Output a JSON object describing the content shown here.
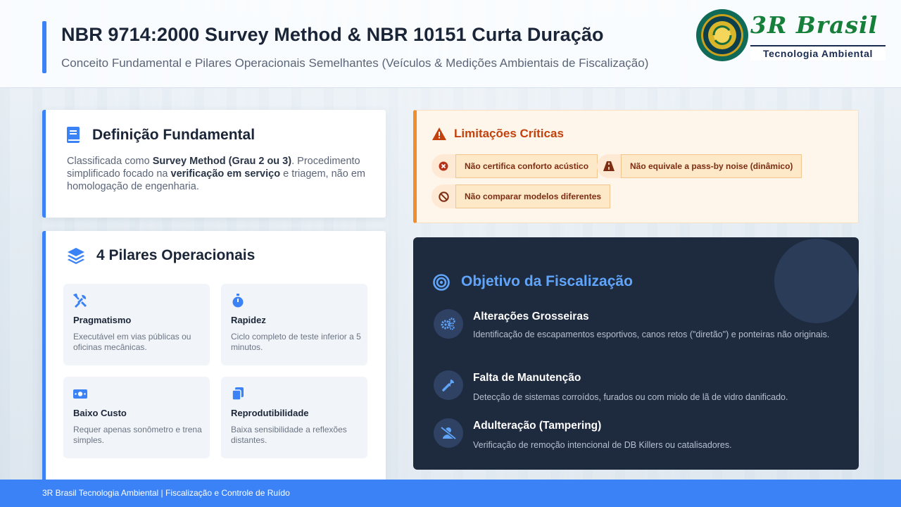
{
  "header": {
    "title": "NBR 9714:2000 Survey Method & NBR 10151 Curta Duração",
    "subtitle": "Conceito Fundamental e Pilares Operacionais Semelhantes (Veículos & Medições Ambientais de Fiscalização)",
    "logo": {
      "brand": "3R Brasil",
      "tagline": "Tecnologia Ambiental"
    }
  },
  "definition": {
    "icon": "book-icon",
    "title": "Definição Fundamental",
    "text_1": "Classificada como ",
    "bold_1": "Survey Method (Grau 2 ou 3)",
    "text_2": ". Procedimento simplificado focado na ",
    "bold_2": "verificação em serviço",
    "text_3": " e triagem, não em homologação de engenharia."
  },
  "pillars": {
    "icon": "layers-icon",
    "title": "4 Pilares Operacionais",
    "items": [
      {
        "icon": "tools-icon",
        "name": "Pragmatismo",
        "desc": "Executável em vias públicas ou oficinas mecânicas."
      },
      {
        "icon": "stopwatch-icon",
        "name": "Rapidez",
        "desc": "Ciclo completo de teste inferior a 5 minutos."
      },
      {
        "icon": "money-icon",
        "name": "Baixo Custo",
        "desc": "Requer apenas sonômetro e trena simples."
      },
      {
        "icon": "copy-icon",
        "name": "Reprodutibilidade",
        "desc": "Baixa sensibilidade a reflexões distantes."
      }
    ]
  },
  "limitations": {
    "icon": "warning-icon",
    "title": "Limitações Críticas",
    "items": [
      {
        "icon": "x-circle-icon",
        "text": "Não certifica conforto acústico"
      },
      {
        "icon": "road-icon",
        "text": "Não equivale a pass-by noise (dinâmico)"
      },
      {
        "icon": "ban-icon",
        "text": "Não comparar modelos diferentes"
      }
    ]
  },
  "objective": {
    "icon": "target-icon",
    "title": "Objetivo da Fiscalização",
    "items": [
      {
        "icon": "gears-icon",
        "name": "Alterações Grosseiras",
        "desc": "Identificação de escapamentos esportivos, canos retos (\"diretão\") e ponteiras não originais."
      },
      {
        "icon": "wrench-icon",
        "name": "Falta de Manutenção",
        "desc": "Detecção de sistemas corroídos, furados ou com miolo de lã de vidro danificado."
      },
      {
        "icon": "user-slash-icon",
        "name": "Adulteração (Tampering)",
        "desc": "Verificação de remoção intencional de DB Killers ou catalisadores."
      }
    ]
  },
  "footer": {
    "text": "3R Brasil Tecnologia Ambiental | Fiscalização e Controle de Ruído"
  }
}
